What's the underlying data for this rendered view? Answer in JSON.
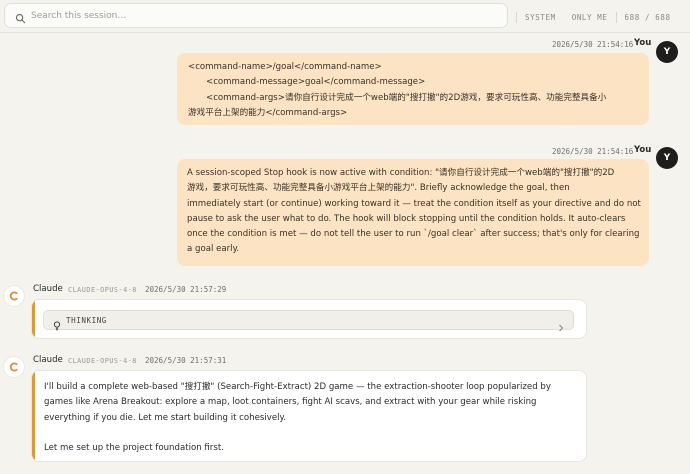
{
  "search": {
    "placeholder": "Search this session…"
  },
  "filters": {
    "system": "SYSTEM",
    "only_me": "ONLY ME",
    "count": "688 / 688"
  },
  "messages": [
    {
      "role": "user",
      "timestamp": "2026/5/30 21:54:16",
      "author": "You",
      "avatar": "Y",
      "lines": [
        "<command-name>/goal</command-name>",
        "<command-message>goal</command-message>",
        "<command-args>请你自行设计完成一个web端的\"搜打撤\"的2D游戏，要求可玩性高、功能完整具备小",
        "游戏平台上架的能力</command-args>"
      ]
    },
    {
      "role": "user",
      "timestamp": "2026/5/30 21:54:16",
      "author": "You",
      "avatar": "Y",
      "lines": [
        "A session-scoped Stop hook is now active with condition: \"请你自行设计完成一个web端的\"搜打撤\"的2D",
        "游戏，要求可玩性高、功能完整具备小游戏平台上架的能力\". Briefly acknowledge the goal, then",
        "immediately start (or continue) working toward it — treat the condition itself as your directive and do not",
        "pause to ask the user what to do. The hook will block stopping until the condition holds. It auto-clears",
        "once the condition is met — do not tell the user to run `/goal clear` after success; that's only for clearing",
        "a goal early."
      ]
    },
    {
      "role": "assistant",
      "author": "Claude",
      "model": "CLAUDE-OPUS-4-8",
      "timestamp": "2026/5/30 21:57:29",
      "thinking_label": "THINKING"
    },
    {
      "role": "assistant",
      "author": "Claude",
      "model": "CLAUDE-OPUS-4-8",
      "timestamp": "2026/5/30 21:57:31",
      "lines": [
        "I'll build a complete web-based \"搜打撤\" (Search-Fight-Extract) 2D game — the extraction-shooter loop popularized by",
        "games like Arena Breakout: explore a map, loot containers, fight AI scavs, and extract with your gear while risking",
        "everything if you die. Let me start building it cohesively.",
        "Let me set up the project foundation first."
      ]
    }
  ],
  "colors": {
    "background": "#f4f3ee",
    "user_bubble": "#fbe3c4",
    "assistant_accent": "#d99a3c",
    "claude_logo": "#d98a3a"
  },
  "icons": [
    "search-icon",
    "lightbulb-icon",
    "chevron-right-icon",
    "claude-logo-icon"
  ]
}
